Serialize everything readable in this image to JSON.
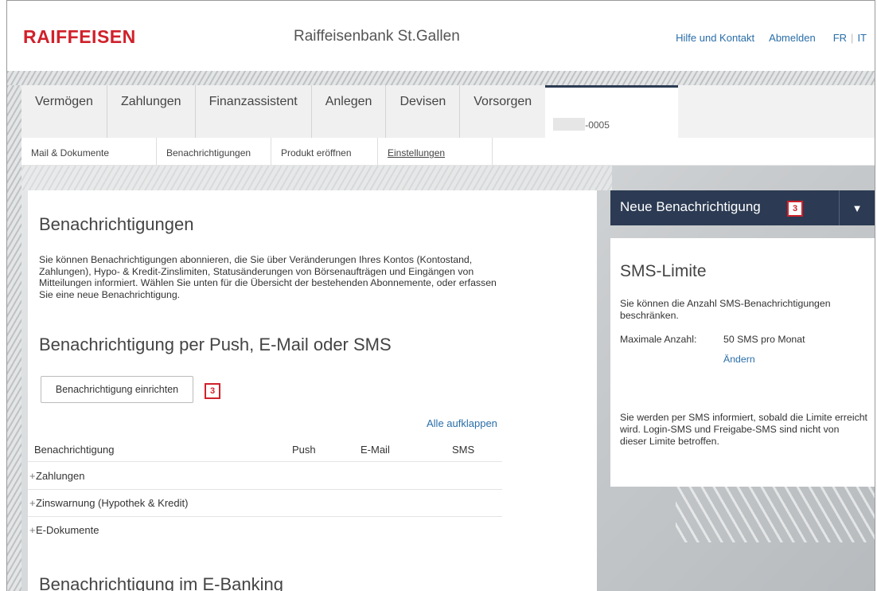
{
  "header": {
    "logo": "RAIFFEISEN",
    "bank_name": "Raiffeisenbank St.Gallen",
    "help_link": "Hilfe und Kontakt",
    "logout_link": "Abmelden",
    "lang_fr": "FR",
    "lang_it": "IT"
  },
  "main_nav": {
    "items": [
      "Vermögen",
      "Zahlungen",
      "Finanzassistent",
      "Anlegen",
      "Devisen",
      "Vorsorgen"
    ],
    "account_suffix": "-0005"
  },
  "sub_nav": {
    "items": [
      "Mail & Dokumente",
      "Benachrichtigungen",
      "Produkt eröffnen",
      "Einstellungen "
    ]
  },
  "content": {
    "title": "Benachrichtigungen",
    "intro": "Sie können Benachrichtigungen abonnieren, die Sie über Veränderungen Ihres Kontos (Kontostand, Zahlungen), Hypo- & Kredit-Zinslimiten, Statusänderungen von Börsenaufträgen und Eingängen von Mitteilungen informiert. Wählen Sie unten für die Übersicht der bestehenden Abonnemente, oder erfassen Sie eine neue Benachrichtigung.",
    "section1_title": "Benachrichtigung per Push, E-Mail oder SMS",
    "setup_button": "Benachrichtigung einrichten",
    "setup_badge": "3",
    "expand_all": "Alle aufklappen",
    "table_headers": {
      "name": "Benachrichtigung",
      "push": "Push",
      "email": "E-Mail",
      "sms": "SMS"
    },
    "rows": [
      {
        "plus": "+",
        "label": "Zahlungen"
      },
      {
        "plus": "+",
        "label": "Zinswarnung (Hypothek & Kredit)"
      },
      {
        "plus": "+",
        "label": "E-Dokumente"
      }
    ],
    "section2_title": "Benachrichtigung im E-Banking"
  },
  "sidebar": {
    "new_notification": "Neue Benachrichtigung",
    "new_badge": "3",
    "dropdown_icon": "caret-down-icon",
    "sms_title": "SMS-Limite",
    "sms_intro": "Sie können die Anzahl SMS-Benachrichtigungen beschränken.",
    "max_label": "Maximale Anzahl:",
    "max_value": "50 SMS pro Monat",
    "change_link": "Ändern",
    "footer": "Sie werden per SMS informiert, sobald die Limite erreicht wird. Login-SMS und Freigabe-SMS sind nicht von dieser Limite betroffen."
  },
  "colors": {
    "brand_red": "#d0212b",
    "nav_dark": "#2c3b53",
    "link_blue": "#2a6ea8"
  }
}
